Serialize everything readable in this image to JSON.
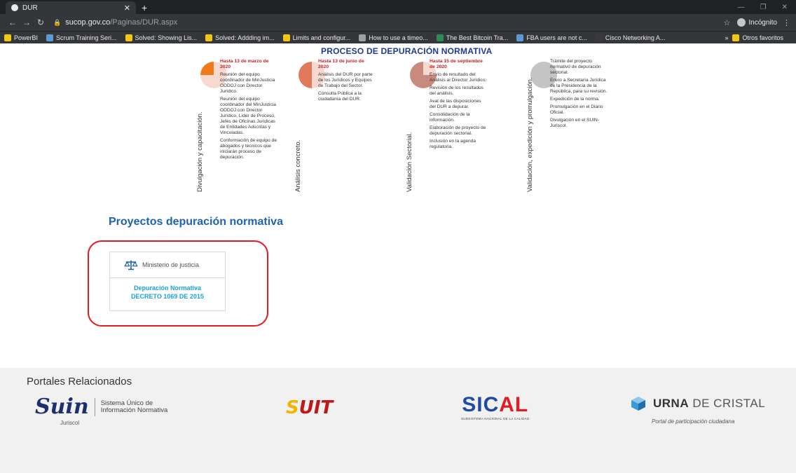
{
  "browser": {
    "tab_title": "DUR",
    "new_tab": "+",
    "url_host": "sucop.gov.co",
    "url_path": "/Paginas/DUR.aspx",
    "incognito_label": "Incógnito",
    "bookmarks": [
      {
        "label": "PowerBI",
        "color": "#f2c811"
      },
      {
        "label": "Scrum Training Seri...",
        "color": "#5b9bd5"
      },
      {
        "label": "Solved: Showing Lis...",
        "color": "#f2c811"
      },
      {
        "label": "Solved: Addding im...",
        "color": "#f2c811"
      },
      {
        "label": "Limits and configur...",
        "color": "#f2c811"
      },
      {
        "label": "How to use a timeo...",
        "color": "#9aa0a6"
      },
      {
        "label": "The Best Bitcoin Tra...",
        "color": "#2e8b57"
      },
      {
        "label": "FBA users are not c...",
        "color": "#5b9bd5"
      },
      {
        "label": "Cisco Networking A...",
        "color": "#3a3a3a"
      }
    ],
    "other_favorites": "Otros favoritos"
  },
  "process": {
    "title": "PROCESO DE DEPURACIÓN NORMATIVA",
    "stages": [
      {
        "label": "Divulgación y capacitación.",
        "date": "Hasta 13 de marzo de 2020",
        "fill": 0.25,
        "color": "#f07a1a",
        "items": [
          "Reunión del equipo coordinador de MinJusticia ODDOJ con Director Jurídico.",
          "Reunión del equipo coordinador del MinJusticia ODDOJ con Director Jurídico, Líder de Proceso, Jefes de Oficinas Jurídicas de Entidades Adscritas y Vinculadas.",
          "Conformación de equipo de abogados y técnicos que iniciarán proceso de depuración."
        ]
      },
      {
        "label": "Análisis concreto.",
        "date": "Hasta 13 de junio de 2020",
        "fill": 0.5,
        "color": "#e07a5a",
        "items": [
          "Análisis del DUR por parte de los Jurídicos y Equipos de Trabajo del Sector.",
          "Consulta Pública a la ciudadanía del DUR."
        ]
      },
      {
        "label": "Validación Sectorial.",
        "date": "Hasta 15 de septiembre de 2020",
        "fill": 0.75,
        "color": "#c98a7e",
        "items": [
          "Envío de resultado del Análisis al Director Jurídico.",
          "Revisión de los resultados del análisis.",
          "Aval de las disposiciones del DUR a depurar.",
          "Consolidación de la información.",
          "Elaboración de proyecto de depuración sectorial.",
          "Inclusión en la agenda regulatoria."
        ]
      },
      {
        "label": "Validación, expedición y promulgación.",
        "date": "",
        "fill": 1,
        "color": "#c4c4c4",
        "items": [
          "Trámite del proyecto normativo de depuración sectorial.",
          "Envío a Secretaría Jurídica de la Presidencia de la República, para su revisión.",
          "Expedición de la norma.",
          "Promulgación en el Diario Oficial.",
          "Divulgación en el SUIN-Juriscol."
        ]
      }
    ]
  },
  "projects": {
    "title": "Proyectos depuración normativa",
    "card": {
      "ministry": "Ministerio de justicia",
      "line1": "Depuración Normativa",
      "line2": "DECRETO 1069 DE 2015"
    }
  },
  "footer": {
    "title": "Portales Relacionados",
    "suin": {
      "mark": "Suin",
      "text1": "Sistema Único de",
      "text2": "Información Normativa",
      "sub": "Juriscol"
    },
    "suit": {
      "s": "S",
      "rest": "UIT"
    },
    "sical": {
      "mark_a": "SIC",
      "mark_b": "AL",
      "sub": "SUBSISTEMA NACIONAL DE LA CALIDAD"
    },
    "urna": {
      "brand_a": "URNA",
      "brand_b": " DE CRISTAL",
      "sub": "Portal de participación ciudadana"
    }
  }
}
